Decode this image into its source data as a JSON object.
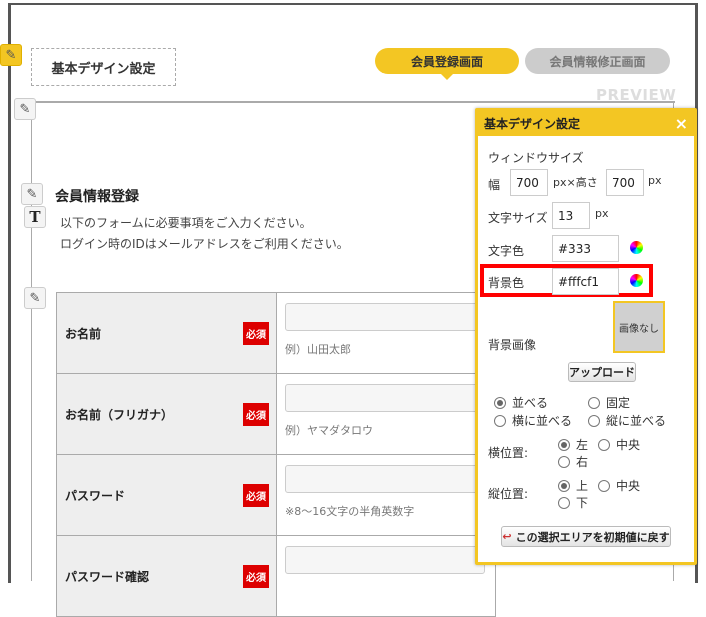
{
  "header": {
    "design_button": "基本デザイン設定",
    "tabs": [
      {
        "label": "会員登録画面",
        "active": true
      },
      {
        "label": "会員情報修正画面",
        "active": false
      }
    ],
    "preview": "PREVIEW"
  },
  "form": {
    "title": "会員情報登録",
    "desc1": "以下のフォームに必要事項をご入力ください。",
    "desc2": "ログイン時のIDはメールアドレスをご利用ください。",
    "rows": [
      {
        "label": "お名前",
        "required": "必須",
        "hint": "例）山田太郎"
      },
      {
        "label": "お名前（フリガナ）",
        "required": "必須",
        "hint": "例）ヤマダタロウ"
      },
      {
        "label": "パスワード",
        "required": "必須",
        "hint": "※8～16文字の半角英数字"
      },
      {
        "label": "パスワード確認",
        "required": "必須",
        "hint": ""
      }
    ]
  },
  "panel": {
    "title": "基本デザイン設定",
    "close": "×",
    "window_size": "ウィンドウサイズ",
    "width_label": "幅",
    "width": "700",
    "px_x_height": "px×高さ",
    "height": "700",
    "px": "px",
    "font_size_label": "文字サイズ",
    "font_size": "13",
    "text_color_label": "文字色",
    "text_color": "#333",
    "bg_color_label": "背景色",
    "bg_color": "#fffcf1",
    "bg_image_label": "背景画像",
    "no_image": "画像なし",
    "upload": "アップロード",
    "repeat": [
      "並べる",
      "固定",
      "横に並べる",
      "縦に並べる"
    ],
    "h_pos_label": "横位置:",
    "h_pos": [
      "左",
      "中央",
      "右"
    ],
    "v_pos_label": "縦位置:",
    "v_pos": [
      "上",
      "中央",
      "下"
    ],
    "reset": "この選択エリアを初期値に戻す"
  },
  "colors": {
    "accent": "#f3c623",
    "required": "#dd0000",
    "highlight": "#ff0000"
  }
}
